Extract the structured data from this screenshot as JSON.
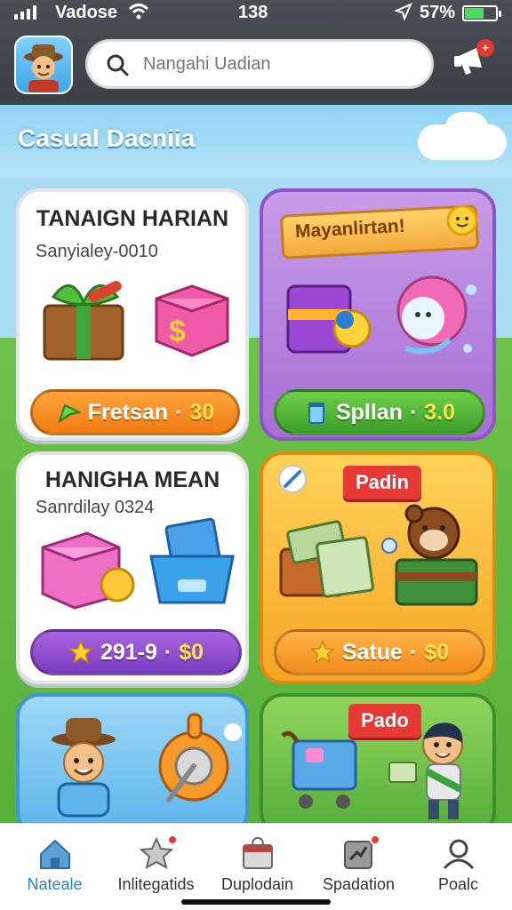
{
  "status_bar": {
    "carrier": "Vadose",
    "time": "138",
    "battery": "57%"
  },
  "header": {
    "search_placeholder": "Nangahi Uadian",
    "notification_count": "+"
  },
  "section": {
    "title": "Casual Dacniia"
  },
  "cards": [
    {
      "title": "TANAIGN HARIAN",
      "subtitle": "Sanyialey-0010",
      "button_label": "Fretsan",
      "button_price": "30",
      "button_icon": "arrow-icon"
    },
    {
      "ribbon": "Mayanlirtan!",
      "button_label": "Spllan",
      "button_price": "3.0",
      "button_icon": "jar-icon"
    },
    {
      "title": "HANIGHA MEAN",
      "subtitle": "Sanrdilay 0324",
      "button_label": "291-9",
      "button_price": "$0",
      "button_icon": "star-icon"
    },
    {
      "tag": "Padin",
      "button_label": "Satue",
      "button_price": "$0",
      "button_icon": "star-icon"
    },
    {
      "title": ""
    },
    {
      "tag": "Pado"
    }
  ],
  "bottom_nav": [
    {
      "label": "Nateale",
      "icon": "home-icon",
      "active": true
    },
    {
      "label": "Inlitegatids",
      "icon": "star-icon",
      "active": false
    },
    {
      "label": "Duplodain",
      "icon": "shop-icon",
      "active": false
    },
    {
      "label": "Spadation",
      "icon": "puzzle-icon",
      "active": false
    },
    {
      "label": "Poalc",
      "icon": "profile-icon",
      "active": false
    }
  ],
  "colors": {
    "accent_blue": "#2f7fc3",
    "price_yellow": "#ffe34d",
    "badge_red": "#e53935"
  }
}
